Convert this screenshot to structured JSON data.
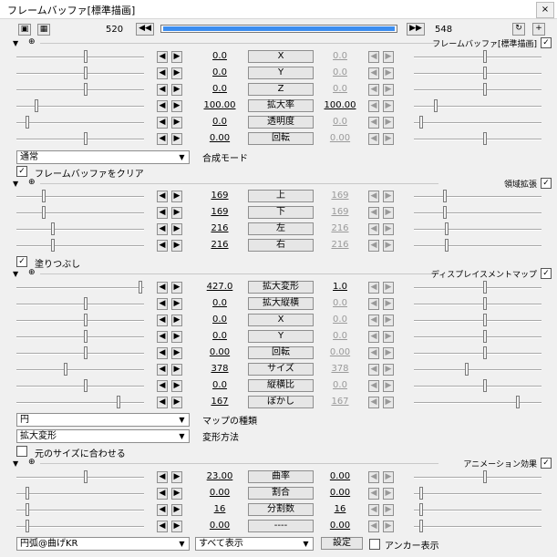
{
  "window": {
    "title": "フレームバッファ[標準描画]",
    "close": "×"
  },
  "timeline": {
    "start": "520",
    "end": "548",
    "progress": 1.0
  },
  "sections": {
    "framebuffer": {
      "name": "フレームバッファ[標準描画]",
      "checked": "✓"
    },
    "region": {
      "name": "領域拡張",
      "checked": "✓"
    },
    "displacement": {
      "name": "ディスプレイスメントマップ",
      "checked": "✓"
    },
    "animation": {
      "name": "アニメーション効果",
      "checked": "✓"
    }
  },
  "framebuffer_rows": [
    {
      "label": "X",
      "v1": "0.0",
      "v2": "0.0"
    },
    {
      "label": "Y",
      "v1": "0.0",
      "v2": "0.0"
    },
    {
      "label": "Z",
      "v1": "0.0",
      "v2": "0.0"
    },
    {
      "label": "拡大率",
      "v1": "100.00",
      "v2": "100.00"
    },
    {
      "label": "透明度",
      "v1": "0.0",
      "v2": "0.0"
    },
    {
      "label": "回転",
      "v1": "0.00",
      "v2": "0.00"
    }
  ],
  "blend": {
    "value": "通常",
    "label": "合成モード"
  },
  "clear_buffer": {
    "label": "フレームバッファをクリア",
    "checked": "✓"
  },
  "region_rows": [
    {
      "label": "上",
      "v1": "169",
      "v2": "169"
    },
    {
      "label": "下",
      "v1": "169",
      "v2": "169"
    },
    {
      "label": "左",
      "v1": "216",
      "v2": "216"
    },
    {
      "label": "右",
      "v1": "216",
      "v2": "216"
    }
  ],
  "fill": {
    "label": "塗りつぶし",
    "checked": "✓"
  },
  "displacement_rows": [
    {
      "label": "拡大変形",
      "v1": "427.0",
      "v2": "1.0"
    },
    {
      "label": "拡大縦横",
      "v1": "0.0",
      "v2": "0.0"
    },
    {
      "label": "X",
      "v1": "0.0",
      "v2": "0.0"
    },
    {
      "label": "Y",
      "v1": "0.0",
      "v2": "0.0"
    },
    {
      "label": "回転",
      "v1": "0.00",
      "v2": "0.00"
    },
    {
      "label": "サイズ",
      "v1": "378",
      "v2": "378"
    },
    {
      "label": "縦横比",
      "v1": "0.0",
      "v2": "0.0"
    },
    {
      "label": "ぼかし",
      "v1": "167",
      "v2": "167"
    }
  ],
  "map_type": {
    "value": "円",
    "label": "マップの種類"
  },
  "transform": {
    "value": "拡大変形",
    "label": "変形方法"
  },
  "fit_size": {
    "label": "元のサイズに合わせる",
    "checked": ""
  },
  "animation_rows": [
    {
      "label": "曲率",
      "v1": "23.00",
      "v2": "0.00"
    },
    {
      "label": "割合",
      "v1": "0.00",
      "v2": "0.00"
    },
    {
      "label": "分割数",
      "v1": "16",
      "v2": "16"
    },
    {
      "label": "----",
      "v1": "0.00",
      "v2": "0.00"
    }
  ],
  "footer": {
    "effect": "円弧@曲げKR",
    "display": "すべて表示",
    "settings": "設定",
    "anchor": "アンカー表示"
  },
  "colors": {
    "accent": "#3b8df0",
    "disabled": "#9a9a9a"
  }
}
